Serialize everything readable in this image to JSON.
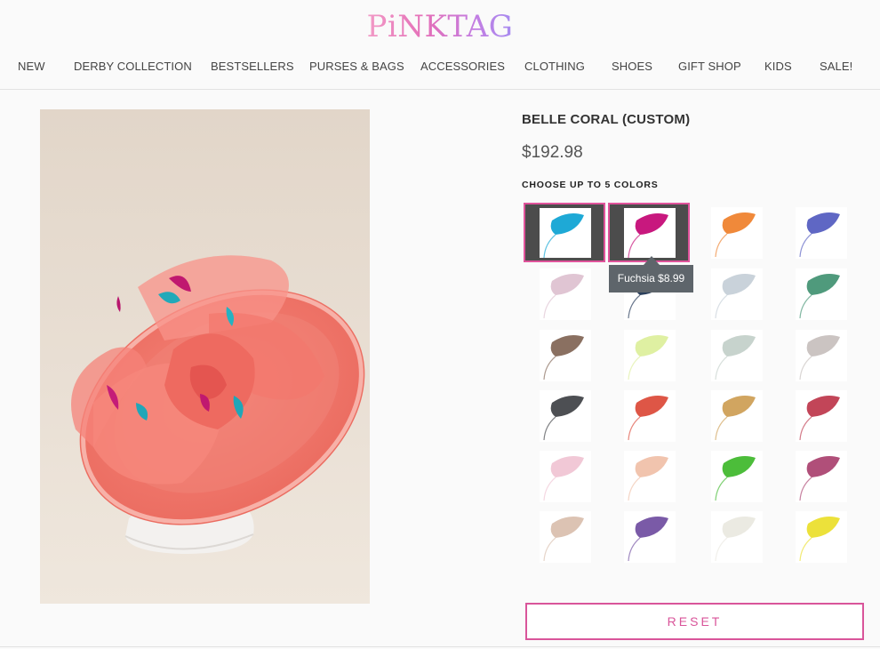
{
  "brand": {
    "logo": "PiNKTAG"
  },
  "nav": {
    "items": [
      "NEW",
      "DERBY COLLECTION",
      "BESTSELLERS",
      "PURSES & BAGS",
      "ACCESSORIES",
      "CLOTHING",
      "SHOES",
      "GIFT SHOP",
      "KIDS",
      "SALE!"
    ]
  },
  "product": {
    "title": "BELLE CORAL (CUSTOM)",
    "price": "$192.98",
    "image": "coral-sinamay-fascinator-hat-photo"
  },
  "colors": {
    "label": "CHOOSE UP TO 5 COLORS",
    "swatches": [
      {
        "color": "#1ea9d6",
        "selected": true
      },
      {
        "color": "#c8187e",
        "selected": true
      },
      {
        "color": "#f0893a",
        "selected": false
      },
      {
        "color": "#5f67c4",
        "selected": false
      },
      {
        "color": "#e0c5d3",
        "selected": false
      },
      {
        "color": "#2b3f5c",
        "selected": false
      },
      {
        "color": "#c9d2da",
        "selected": false
      },
      {
        "color": "#4f9a7c",
        "selected": false
      },
      {
        "color": "#8a7061",
        "selected": false
      },
      {
        "color": "#dff0a2",
        "selected": false
      },
      {
        "color": "#c7d3cd",
        "selected": false
      },
      {
        "color": "#cbc4c2",
        "selected": false
      },
      {
        "color": "#4d4f53",
        "selected": false
      },
      {
        "color": "#de5646",
        "selected": false
      },
      {
        "color": "#d1a560",
        "selected": false
      },
      {
        "color": "#c24558",
        "selected": false
      },
      {
        "color": "#f1c8d6",
        "selected": false
      },
      {
        "color": "#f1c4ae",
        "selected": false
      },
      {
        "color": "#4cbd3a",
        "selected": false
      },
      {
        "color": "#b04f79",
        "selected": false
      },
      {
        "color": "#dcc3b3",
        "selected": false
      },
      {
        "color": "#7a5aa7",
        "selected": false
      },
      {
        "color": "#ebeae2",
        "selected": false
      },
      {
        "color": "#ece13a",
        "selected": false
      }
    ],
    "tooltip": "Fuchsia $8.99"
  },
  "reset_label": "RESET"
}
